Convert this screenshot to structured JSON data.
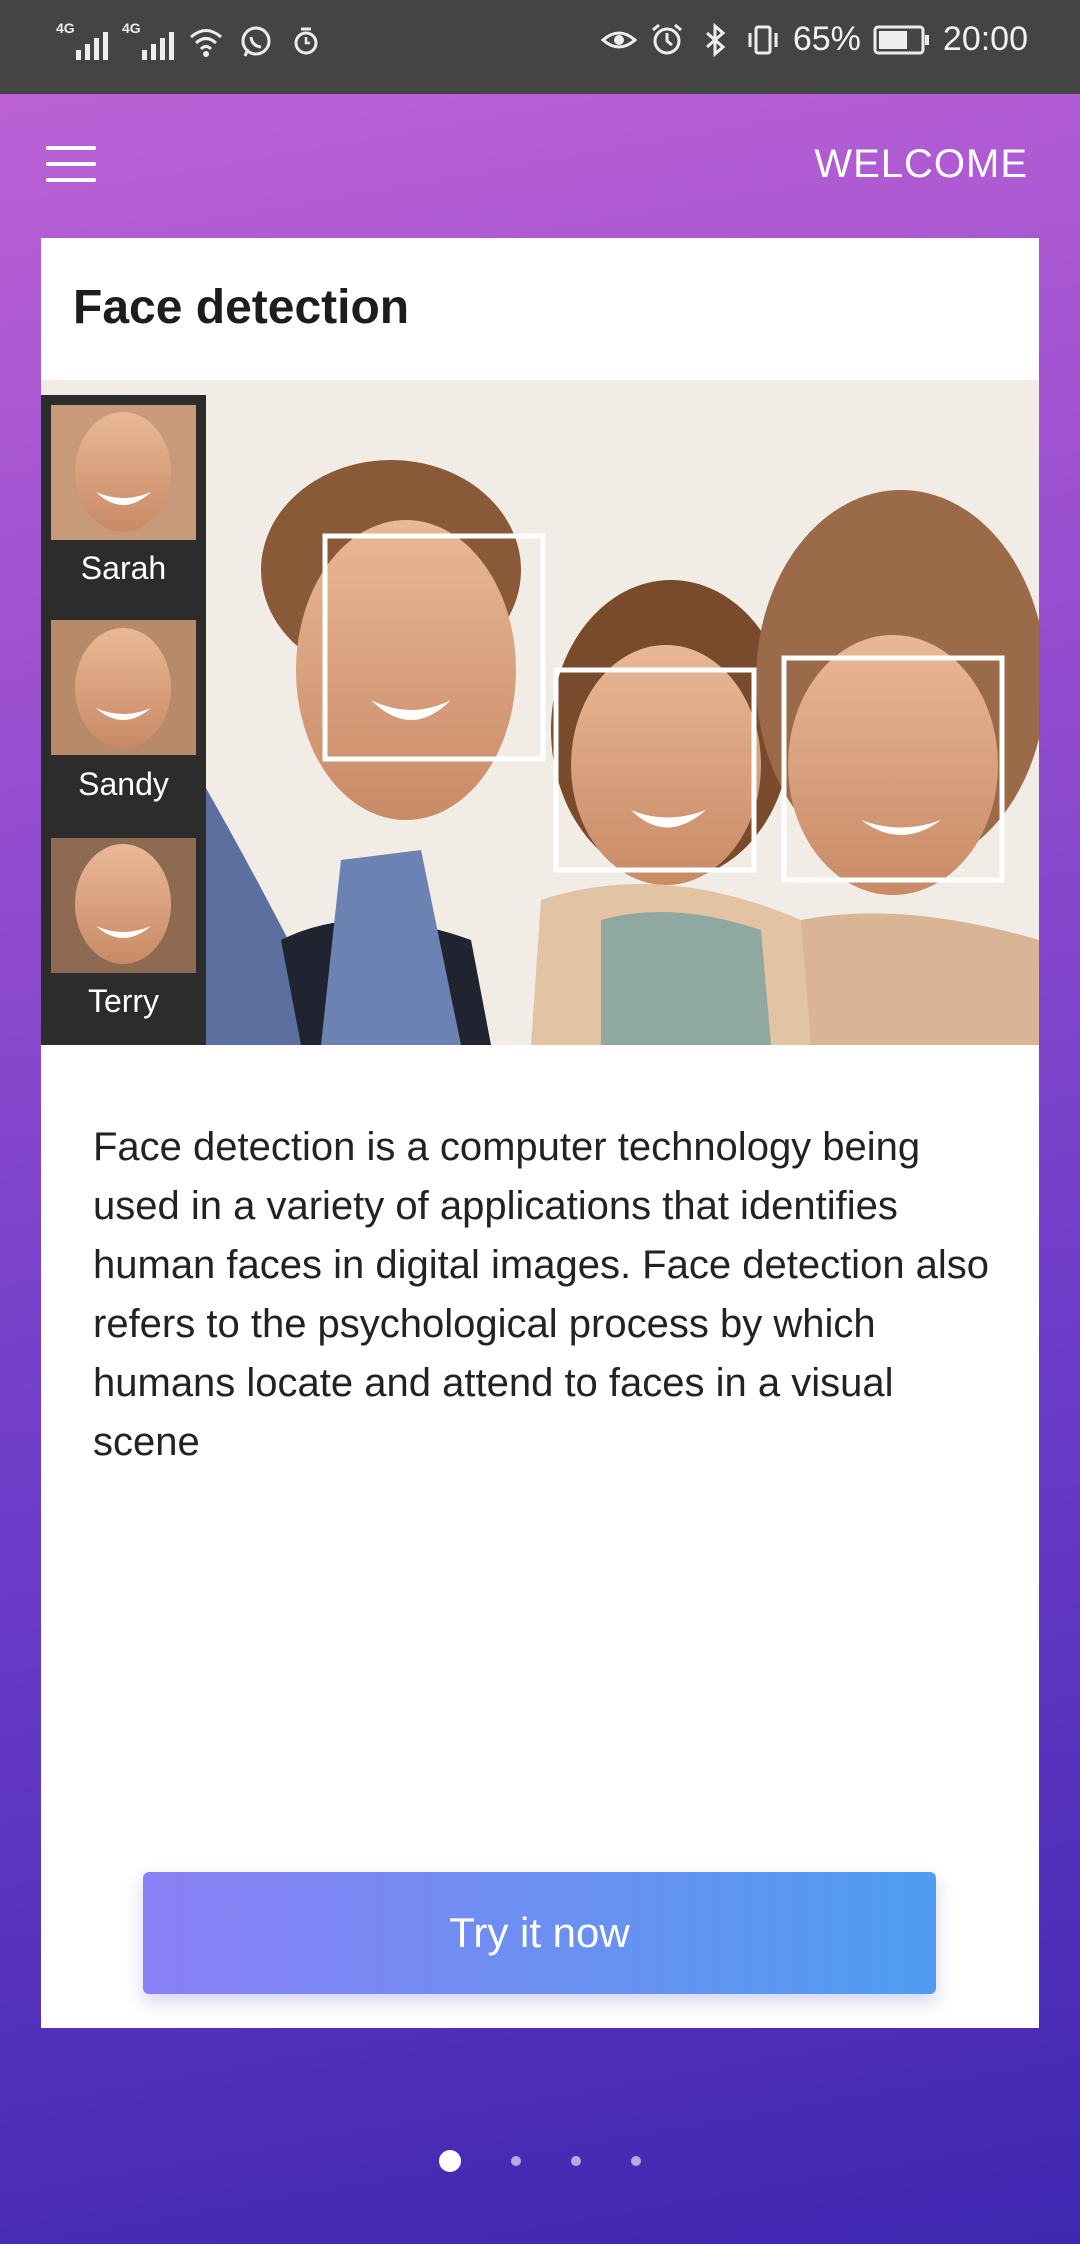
{
  "status_bar": {
    "network1": "4G",
    "network2": "4G",
    "battery": "65%",
    "time": "20:00",
    "icons": [
      "signal-icon",
      "signal-icon",
      "wifi-icon",
      "whatsapp-icon",
      "alarm-clock-icon",
      "eye-icon",
      "alarm-icon",
      "bluetooth-icon",
      "vibrate-icon",
      "battery-icon"
    ]
  },
  "app_bar": {
    "menu_icon": "hamburger-menu-icon",
    "welcome_label": "WELCOME"
  },
  "card": {
    "title": "Face detection",
    "hero": {
      "thumbnails": [
        {
          "name": "Sarah"
        },
        {
          "name": "Sandy"
        },
        {
          "name": "Terry"
        }
      ]
    },
    "description": "Face detection is a computer technology being used in a variety of applications that identifies human faces in digital images. Face detection also refers to the psychological process by which humans locate and attend to faces in a visual scene",
    "cta_label": "Try it now"
  },
  "pager": {
    "total": 4,
    "active_index": 0
  },
  "colors": {
    "bg_gradient_top": "#c064d6",
    "bg_gradient_bottom": "#3f27b0",
    "cta_start": "#8a7ff5",
    "cta_end": "#4f9df2",
    "status_bar": "#444444"
  }
}
